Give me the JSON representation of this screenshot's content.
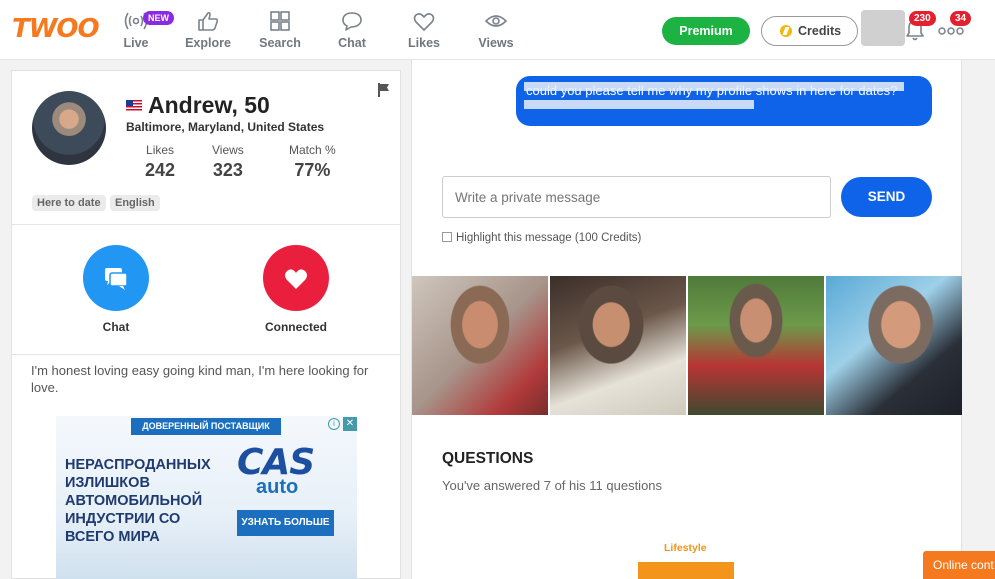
{
  "brand": {
    "logo": "TWOO",
    "accent": "#f57a1f",
    "blue": "#0e63e8",
    "green": "#1db343",
    "red": "#e5202e"
  },
  "nav": {
    "items": [
      {
        "label": "Live",
        "icon": "live-broadcast-icon"
      },
      {
        "label": "Explore",
        "icon": "thumbs-up-icon"
      },
      {
        "label": "Search",
        "icon": "grid-icon"
      },
      {
        "label": "Chat",
        "icon": "speech-bubble-icon"
      },
      {
        "label": "Likes",
        "icon": "heart-outline-icon"
      },
      {
        "label": "Views",
        "icon": "eye-icon"
      }
    ],
    "new_badge": "NEW",
    "premium_label": "Premium",
    "credits_label": "Credits",
    "notifications_count": "230",
    "more_count": "34"
  },
  "profile": {
    "name": "Andrew, 50",
    "location": "Baltimore, Maryland, United States",
    "stats": [
      {
        "label": "Likes",
        "value": "242"
      },
      {
        "label": "Views",
        "value": "323"
      },
      {
        "label": "Match %",
        "value": "77%"
      }
    ],
    "tags": [
      "Here to date",
      "English"
    ],
    "actions": {
      "chat_label": "Chat",
      "connected_label": "Connected"
    },
    "bio": "I'm honest loving easy going kind man, I'm here looking for love."
  },
  "ad": {
    "header": "ДОВЕРЕННЫЙ ПОСТАВЩИК",
    "text": "Нераспроданных излишков автомобильной индустрии со всего мира",
    "logo_top": "CAS",
    "logo_bottom": "auto",
    "cta": "УЗНАТЬ БОЛЬШЕ",
    "info": "i",
    "close": "✕"
  },
  "chat": {
    "message": "could you please tell me why my profile shows in here for dates?",
    "input_placeholder": "Write a private message",
    "send_label": "SEND",
    "highlight_label": "Highlight this message (100 Credits)"
  },
  "questions": {
    "title": "QUESTIONS",
    "subtitle": "You've answered 7 of his 11 questions",
    "category": "Lifestyle"
  },
  "online_tab": "Online cont"
}
